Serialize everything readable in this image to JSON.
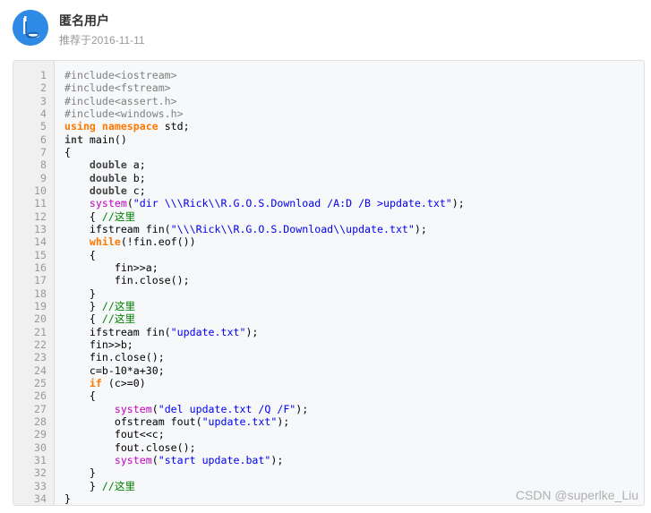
{
  "post": {
    "username": "匿名用户",
    "meta": "推荐于2016-11-11",
    "avatar_icon": "fishing-bobber-icon",
    "accent": "#2f8ae6"
  },
  "code": [
    [
      [
        "pp",
        "#include<iostream>"
      ]
    ],
    [
      [
        "pp",
        "#include<fstream>"
      ]
    ],
    [
      [
        "pp",
        "#include<assert.h>"
      ]
    ],
    [
      [
        "pp",
        "#include<windows.h>"
      ]
    ],
    [
      [
        "kw",
        "using"
      ],
      [
        "pl",
        " "
      ],
      [
        "kw",
        "namespace"
      ],
      [
        "pl",
        " std;"
      ]
    ],
    [
      [
        "tp",
        "int"
      ],
      [
        "pl",
        " main()"
      ]
    ],
    [
      [
        "pl",
        "{"
      ]
    ],
    [
      [
        "pl",
        "    "
      ],
      [
        "tp",
        "double"
      ],
      [
        "pl",
        " a;"
      ]
    ],
    [
      [
        "pl",
        "    "
      ],
      [
        "tp",
        "double"
      ],
      [
        "pl",
        " b;"
      ]
    ],
    [
      [
        "pl",
        "    "
      ],
      [
        "tp",
        "double"
      ],
      [
        "pl",
        " c;"
      ]
    ],
    [
      [
        "pl",
        "    "
      ],
      [
        "fn",
        "system"
      ],
      [
        "pl",
        "("
      ],
      [
        "str",
        "\"dir \\\\\\Rick\\\\R.G.O.S.Download /A:D /B >update.txt\""
      ],
      [
        "pl",
        ");"
      ]
    ],
    [
      [
        "pl",
        "    { "
      ],
      [
        "cmt",
        "//这里"
      ]
    ],
    [
      [
        "pl",
        "    ifstream fin("
      ],
      [
        "str",
        "\"\\\\\\Rick\\\\R.G.O.S.Download\\\\update.txt\""
      ],
      [
        "pl",
        ");"
      ]
    ],
    [
      [
        "pl",
        "    "
      ],
      [
        "kw",
        "while"
      ],
      [
        "pl",
        "(!fin.eof())"
      ]
    ],
    [
      [
        "pl",
        "    {"
      ]
    ],
    [
      [
        "pl",
        "        fin>>a;"
      ]
    ],
    [
      [
        "pl",
        "        fin.close();"
      ]
    ],
    [
      [
        "pl",
        "    }"
      ]
    ],
    [
      [
        "pl",
        "    } "
      ],
      [
        "cmt",
        "//这里"
      ]
    ],
    [
      [
        "pl",
        "    { "
      ],
      [
        "cmt",
        "//这里"
      ]
    ],
    [
      [
        "pl",
        "    ifstream fin("
      ],
      [
        "str",
        "\"update.txt\""
      ],
      [
        "pl",
        ");"
      ]
    ],
    [
      [
        "pl",
        "    fin>>b;"
      ]
    ],
    [
      [
        "pl",
        "    fin.close();"
      ]
    ],
    [
      [
        "pl",
        "    c=b-10*a+30;"
      ]
    ],
    [
      [
        "pl",
        "    "
      ],
      [
        "kw",
        "if"
      ],
      [
        "pl",
        " (c>=0)"
      ]
    ],
    [
      [
        "pl",
        "    {"
      ]
    ],
    [
      [
        "pl",
        "        "
      ],
      [
        "fn",
        "system"
      ],
      [
        "pl",
        "("
      ],
      [
        "str",
        "\"del update.txt /Q /F\""
      ],
      [
        "pl",
        ");"
      ]
    ],
    [
      [
        "pl",
        "        ofstream fout("
      ],
      [
        "str",
        "\"update.txt\""
      ],
      [
        "pl",
        ");"
      ]
    ],
    [
      [
        "pl",
        "        fout<<c;"
      ]
    ],
    [
      [
        "pl",
        "        fout.close();"
      ]
    ],
    [
      [
        "pl",
        "        "
      ],
      [
        "fn",
        "system"
      ],
      [
        "pl",
        "("
      ],
      [
        "str",
        "\"start update.bat\""
      ],
      [
        "pl",
        ");"
      ]
    ],
    [
      [
        "pl",
        "    }"
      ]
    ],
    [
      [
        "pl",
        "    } "
      ],
      [
        "cmt",
        "//这里"
      ]
    ],
    [
      [
        "pl",
        "}"
      ]
    ]
  ],
  "line_numbers": [
    "1",
    "2",
    "3",
    "4",
    "5",
    "6",
    "7",
    "8",
    "9",
    "10",
    "11",
    "12",
    "13",
    "14",
    "15",
    "16",
    "17",
    "18",
    "19",
    "20",
    "21",
    "22",
    "23",
    "24",
    "25",
    "26",
    "27",
    "28",
    "29",
    "30",
    "31",
    "32",
    "33",
    "34",
    ""
  ],
  "watermark": "CSDN @superlke_Liu"
}
